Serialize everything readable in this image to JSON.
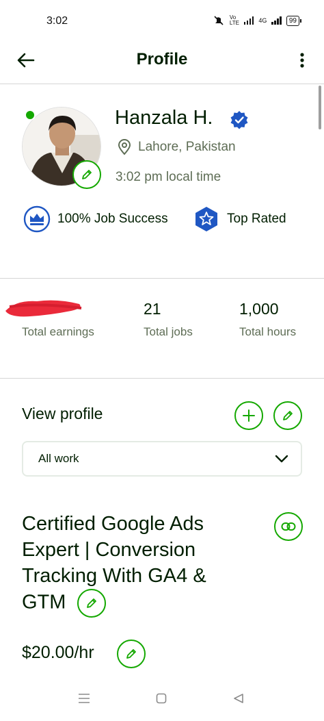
{
  "status_bar": {
    "time": "3:02",
    "network_label": "4G",
    "volte_label": "Vo LTE",
    "battery": "99"
  },
  "app_bar": {
    "title": "Profile"
  },
  "profile": {
    "name": "Hanzala H.",
    "location": "Lahore, Pakistan",
    "local_time": "3:02 pm local time",
    "badges": {
      "job_success": "100% Job Success",
      "top_rated": "Top Rated"
    }
  },
  "stats": [
    {
      "value": "",
      "label": "Total earnings"
    },
    {
      "value": "21",
      "label": "Total jobs"
    },
    {
      "value": "1,000",
      "label": "Total hours"
    }
  ],
  "view_profile": {
    "label": "View profile",
    "select_value": "All work"
  },
  "listing": {
    "headline": "Certified Google Ads Expert | Conversion Tracking With GA4 & GTM",
    "rate": "$20.00/hr"
  },
  "colors": {
    "accent": "#14a800",
    "text": "#001e00",
    "muted": "#5e6d55",
    "badge_blue": "#1f57c3",
    "divider": "#d5d5d5"
  },
  "icons": [
    "back-arrow-icon",
    "more-vertical-icon",
    "verified-icon",
    "location-pin-icon",
    "pencil-icon",
    "crown-icon",
    "star-icon",
    "plus-icon",
    "chevron-down-icon",
    "link-icon"
  ]
}
